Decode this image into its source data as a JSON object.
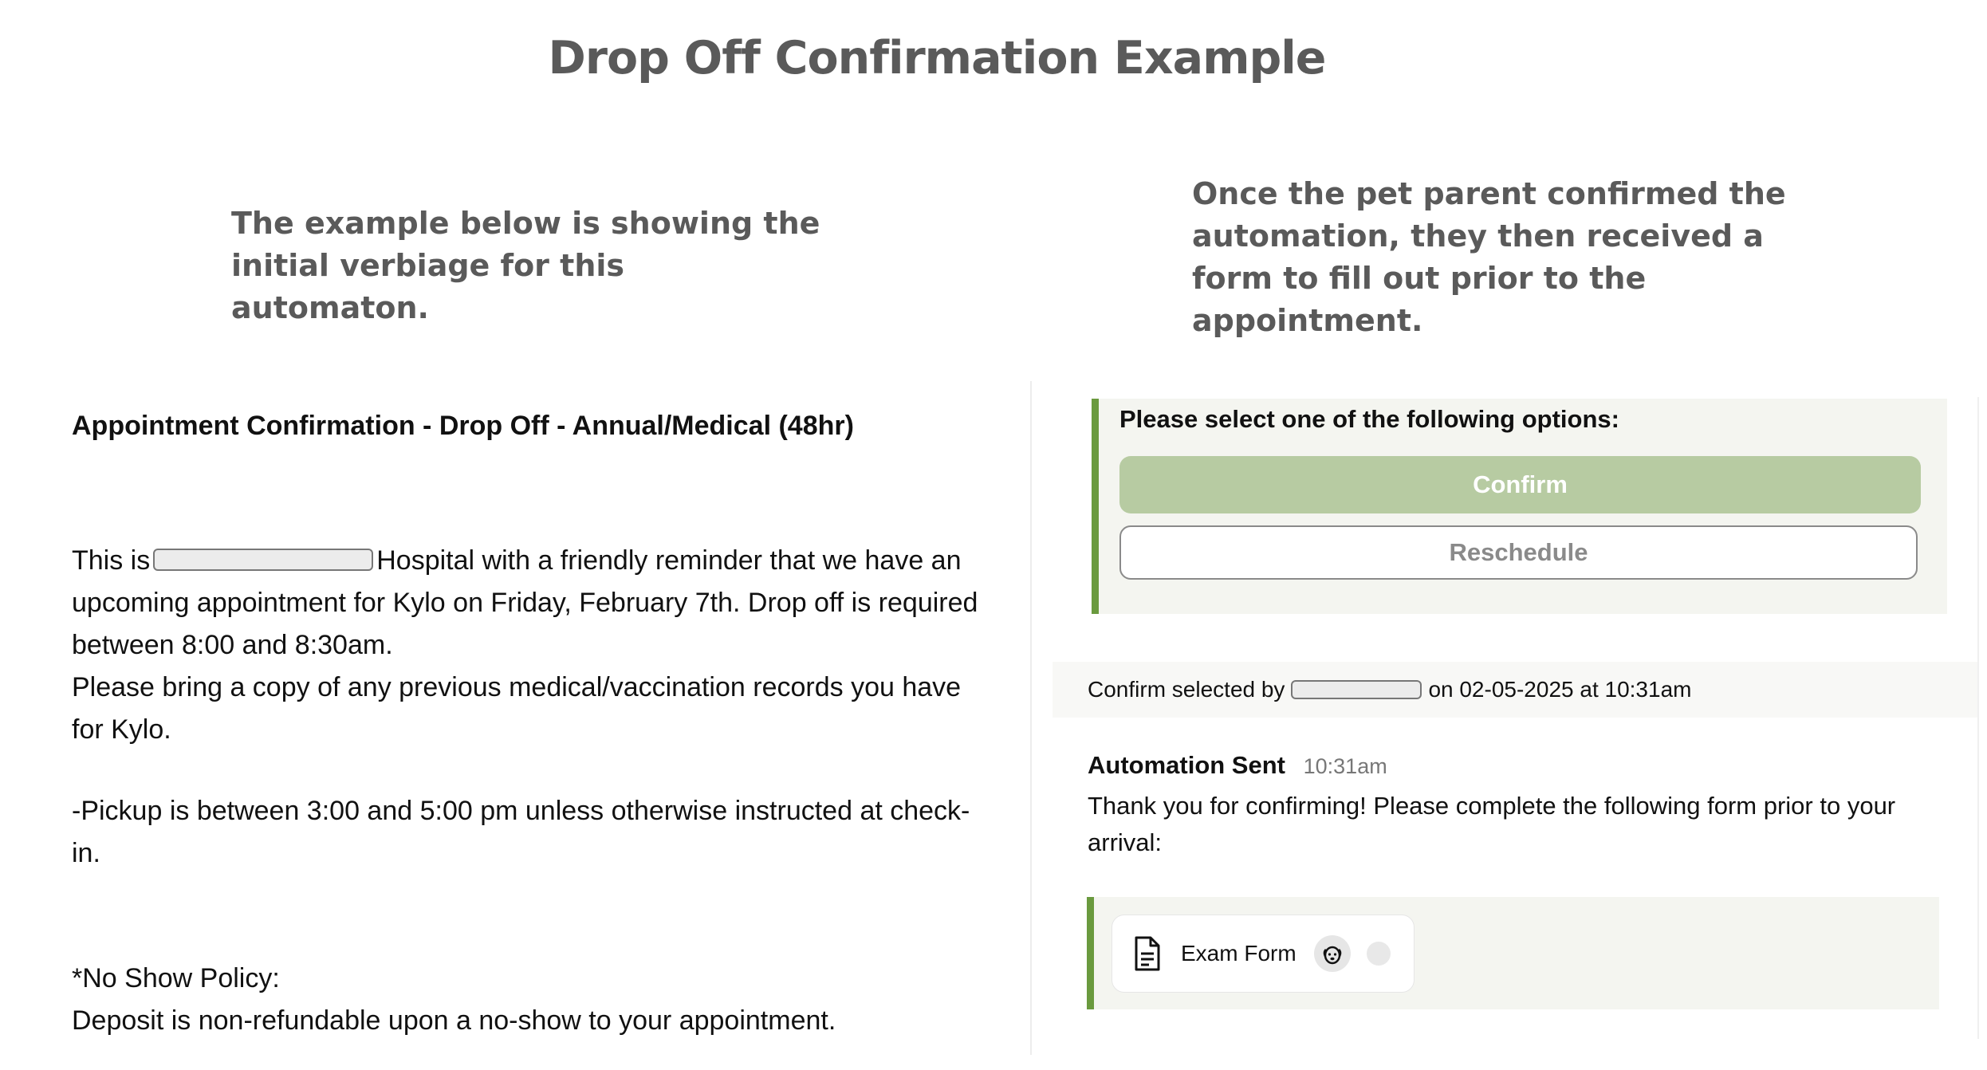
{
  "title": "Drop Off Confirmation Example",
  "intro": {
    "left": "The example below is showing the initial verbiage for this automaton.",
    "right": "Once the pet parent confirmed the automation, they then received a form to fill out prior to the appointment."
  },
  "message": {
    "subject": "Appointment Confirmation - Drop Off - Annual/Medical (48hr)",
    "intro_prefix": "This is",
    "intro_suffix": "Hospital with a friendly reminder that we have an upcoming appointment for Kylo on Friday, February 7th. Drop off is required between 8:00 and 8:30am.",
    "records": "Please bring a copy of any previous medical/vaccination records you have for Kylo.",
    "pickup": "-Pickup is between 3:00 and 5:00 pm unless otherwise instructed at check-in.",
    "policy_title": "*No Show Policy:",
    "policy_text": "Deposit is non-refundable upon a no-show to your appointment."
  },
  "options": {
    "heading": "Please select one of the following options:",
    "confirm_label": "Confirm",
    "reschedule_label": "Reschedule"
  },
  "confirmation": {
    "prefix": "Confirm selected by",
    "suffix": "on 02-05-2025 at 10:31am"
  },
  "automation": {
    "title": "Automation Sent",
    "time": "10:31am",
    "message": "Thank you for confirming! Please complete the following form prior to your arrival:"
  },
  "form": {
    "label": "Exam Form",
    "icons": [
      "document-icon",
      "dog-icon",
      "status-dot"
    ]
  },
  "colors": {
    "accent": "#6a9a3e",
    "confirm_button": "#b7cba2",
    "heading_gray": "#5a5a5a"
  }
}
